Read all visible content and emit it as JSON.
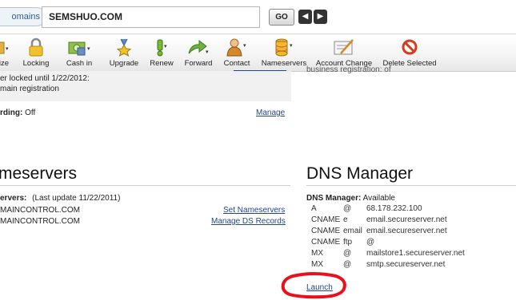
{
  "search": {
    "crumb_label": "omains",
    "domain_value": "SEMSHUO.COM",
    "go_label": "GO",
    "prev_icon": "chevron-left-icon",
    "next_icon": "chevron-right-icon"
  },
  "toolbar": {
    "items": [
      {
        "label": "ize",
        "icon": "resize-icon"
      },
      {
        "label": "Locking",
        "icon": "lock-icon"
      },
      {
        "label": "Cash in",
        "icon": "cash-in-icon"
      },
      {
        "label": "Upgrade",
        "icon": "upgrade-medal-icon"
      },
      {
        "label": "Renew",
        "icon": "renew-icon"
      },
      {
        "label": "Forward",
        "icon": "forward-arrow-icon"
      },
      {
        "label": "Contact",
        "icon": "contact-person-icon"
      },
      {
        "label": "Nameservers",
        "icon": "database-icon"
      },
      {
        "label": "Account Change",
        "icon": "account-change-icon"
      },
      {
        "label": "Delete Selected",
        "icon": "delete-icon"
      }
    ]
  },
  "left": {
    "lock_line1": "er locked until 1/22/2012:",
    "lock_line2": "main registration",
    "forwarding_label": "rding:",
    "forwarding_value": "Off",
    "forwarding_manage": "Manage",
    "nameservers_heading": "meservers",
    "ns_label": "ervers:",
    "ns_update": "(Last update 11/22/2011)",
    "ns_entries": [
      "MAINCONTROL.COM",
      "MAINCONTROL.COM"
    ],
    "set_nameservers": "Set Nameservers",
    "manage_ds": "Manage DS Records"
  },
  "right": {
    "partial_top": "business registration: of",
    "heading": "DNS Manager",
    "status_label": "DNS Manager:",
    "status_value": "Available",
    "records": [
      {
        "type": "A",
        "host": "@",
        "value": "68.178.232.100"
      },
      {
        "type": "CNAME",
        "host": "e",
        "value": "email.secureserver.net"
      },
      {
        "type": "CNAME",
        "host": "email",
        "value": "email.secureserver.net"
      },
      {
        "type": "CNAME",
        "host": "ftp",
        "value": "@"
      },
      {
        "type": "MX",
        "host": "@",
        "value": "mailstore1.secureserver.net"
      },
      {
        "type": "MX",
        "host": "@",
        "value": "smtp.secureserver.net"
      }
    ],
    "launch": "Launch"
  },
  "colors": {
    "link": "#23458b",
    "annotation_circle": "#e8111b",
    "lock_box_bg": "#f1f1f1"
  }
}
